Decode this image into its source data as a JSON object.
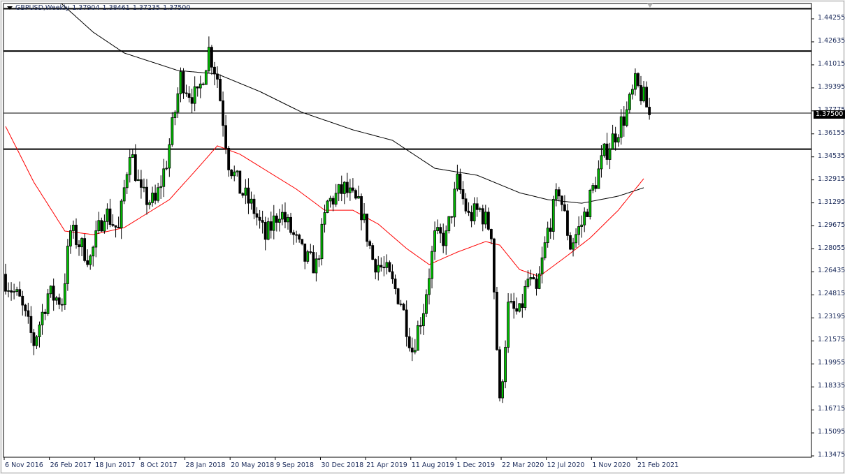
{
  "header": {
    "symbol": "GBPUSD,Weekly",
    "open": "1.37904",
    "high": "1.38461",
    "low": "1.37235",
    "close": "1.37500"
  },
  "current_price_label": "1.37500",
  "colors": {
    "bull": "#00c000",
    "bear": "#000000",
    "ma_fast": "#ff0000",
    "ma_slow": "#000000",
    "hline": "#000000"
  },
  "chart_data": {
    "type": "candlestick",
    "title": "GBPUSD,Weekly",
    "ylim": [
      1.13475,
      1.45
    ],
    "y_ticks": [
      "1.44255",
      "1.42635",
      "1.41015",
      "1.39395",
      "1.37775",
      "1.36155",
      "1.34535",
      "1.32915",
      "1.31295",
      "1.29675",
      "1.28055",
      "1.26435",
      "1.24815",
      "1.23195",
      "1.21575",
      "1.19955",
      "1.18335",
      "1.16715",
      "1.15095",
      "1.13475"
    ],
    "x_ticks": [
      {
        "week": 0,
        "label": "6 Nov 2016"
      },
      {
        "week": 16,
        "label": "26 Feb 2017"
      },
      {
        "week": 32,
        "label": "18 Jun 2017"
      },
      {
        "week": 48,
        "label": "8 Oct 2017"
      },
      {
        "week": 64,
        "label": "28 Jan 2018"
      },
      {
        "week": 80,
        "label": "20 May 2018"
      },
      {
        "week": 96,
        "label": "9 Sep 2018"
      },
      {
        "week": 112,
        "label": "30 Dec 2018"
      },
      {
        "week": 128,
        "label": "21 Apr 2019"
      },
      {
        "week": 144,
        "label": "11 Aug 2019"
      },
      {
        "week": 160,
        "label": "1 Dec 2019"
      },
      {
        "week": 176,
        "label": "22 Mar 2020"
      },
      {
        "week": 192,
        "label": "12 Jul 2020"
      },
      {
        "week": 208,
        "label": "1 Nov 2020"
      },
      {
        "week": 224,
        "label": "21 Feb 2021"
      }
    ],
    "weeks": 229,
    "close_path": [
      [
        0,
        1.2587
      ],
      [
        5,
        1.2439
      ],
      [
        10,
        1.2144
      ],
      [
        15,
        1.2488
      ],
      [
        20,
        1.2439
      ],
      [
        23,
        1.2931
      ],
      [
        30,
        1.2734
      ],
      [
        35,
        1.3078
      ],
      [
        40,
        1.2931
      ],
      [
        44,
        1.3521
      ],
      [
        48,
        1.3177
      ],
      [
        53,
        1.3127
      ],
      [
        57,
        1.3422
      ],
      [
        62,
        1.4013
      ],
      [
        65,
        1.3914
      ],
      [
        68,
        1.3865
      ],
      [
        72,
        1.4209
      ],
      [
        75,
        1.4013
      ],
      [
        79,
        1.3422
      ],
      [
        83,
        1.3226
      ],
      [
        88,
        1.3078
      ],
      [
        92,
        1.2882
      ],
      [
        97,
        1.3078
      ],
      [
        101,
        1.2931
      ],
      [
        106,
        1.2734
      ],
      [
        110,
        1.2685
      ],
      [
        114,
        1.3127
      ],
      [
        120,
        1.3226
      ],
      [
        126,
        1.3078
      ],
      [
        130,
        1.2734
      ],
      [
        135,
        1.2636
      ],
      [
        140,
        1.2439
      ],
      [
        144,
        1.2095
      ],
      [
        148,
        1.239
      ],
      [
        152,
        1.2882
      ],
      [
        156,
        1.2882
      ],
      [
        160,
        1.3275
      ],
      [
        164,
        1.3029
      ],
      [
        168,
        1.3078
      ],
      [
        172,
        1.2931
      ],
      [
        175,
        1.1701
      ],
      [
        178,
        1.239
      ],
      [
        182,
        1.2341
      ],
      [
        185,
        1.2587
      ],
      [
        188,
        1.2488
      ],
      [
        192,
        1.2931
      ],
      [
        196,
        1.3226
      ],
      [
        200,
        1.2832
      ],
      [
        204,
        1.298
      ],
      [
        208,
        1.3226
      ],
      [
        212,
        1.3472
      ],
      [
        216,
        1.3619
      ],
      [
        220,
        1.3767
      ],
      [
        223,
        1.3963
      ],
      [
        226,
        1.3865
      ],
      [
        228,
        1.375
      ]
    ],
    "ma_fast": [
      [
        0,
        1.3668
      ],
      [
        10,
        1.3275
      ],
      [
        21,
        1.2931
      ],
      [
        31,
        1.2906
      ],
      [
        42,
        1.2955
      ],
      [
        48,
        1.3029
      ],
      [
        58,
        1.3152
      ],
      [
        68,
        1.3373
      ],
      [
        75,
        1.3531
      ],
      [
        83,
        1.3472
      ],
      [
        93,
        1.3349
      ],
      [
        103,
        1.3226
      ],
      [
        113,
        1.3078
      ],
      [
        123,
        1.3078
      ],
      [
        132,
        1.298
      ],
      [
        142,
        1.2808
      ],
      [
        150,
        1.2695
      ],
      [
        160,
        1.2783
      ],
      [
        170,
        1.2857
      ],
      [
        175,
        1.2832
      ],
      [
        182,
        1.266
      ],
      [
        189,
        1.2611
      ],
      [
        199,
        1.2759
      ],
      [
        207,
        1.2882
      ],
      [
        217,
        1.3078
      ],
      [
        226,
        1.33
      ]
    ],
    "ma_slow": [
      [
        18,
        1.46
      ],
      [
        20,
        1.4529
      ],
      [
        31,
        1.4332
      ],
      [
        42,
        1.4185
      ],
      [
        61,
        1.4062
      ],
      [
        75,
        1.4037
      ],
      [
        90,
        1.3914
      ],
      [
        105,
        1.3767
      ],
      [
        123,
        1.3644
      ],
      [
        137,
        1.357
      ],
      [
        152,
        1.3373
      ],
      [
        167,
        1.3324
      ],
      [
        182,
        1.3201
      ],
      [
        192,
        1.3152
      ],
      [
        204,
        1.3127
      ],
      [
        217,
        1.3177
      ],
      [
        226,
        1.3236
      ]
    ],
    "horizontal_lines": [
      1.4497,
      1.4199,
      1.3762,
      1.3508
    ]
  }
}
